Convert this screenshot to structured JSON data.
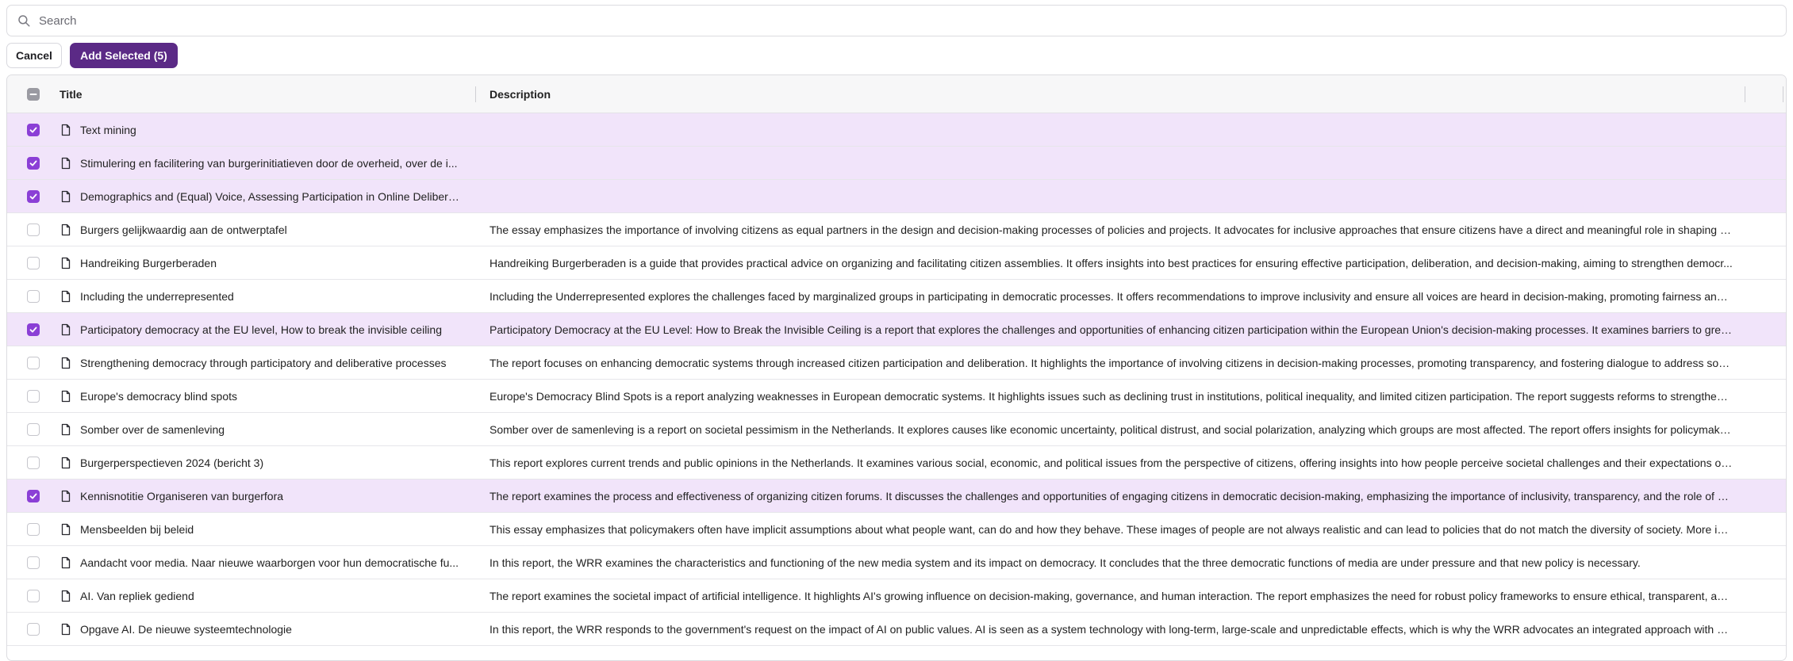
{
  "search": {
    "placeholder": "Search",
    "value": ""
  },
  "actions": {
    "cancel_label": "Cancel",
    "add_label": "Add Selected (5)"
  },
  "colors": {
    "accent": "#5b2a86",
    "checkbox_checked": "#8b3fd6",
    "selected_row": "#f1e4fa"
  },
  "table": {
    "headers": {
      "title": "Title",
      "description": "Description"
    },
    "rows": [
      {
        "title": "Text mining",
        "description": "",
        "selected": true
      },
      {
        "title": "Stimulering en facilitering van burgerinitiatieven door de overheid, over de i...",
        "description": "",
        "selected": true
      },
      {
        "title": "Demographics and (Equal) Voice, Assessing Participation in Online Deliberat...",
        "description": "",
        "selected": true
      },
      {
        "title": "Burgers gelijkwaardig aan de ontwerptafel",
        "description": "The essay emphasizes the importance of involving citizens as equal partners in the design and decision-making processes of policies and projects. It advocates for inclusive approaches that ensure citizens have a direct and meaningful role in shaping deci...",
        "selected": false
      },
      {
        "title": "Handreiking Burgerberaden",
        "description": "Handreiking Burgerberaden is a guide that provides practical advice on organizing and facilitating citizen assemblies. It offers insights into best practices for ensuring effective participation, deliberation, and decision-making, aiming to strengthen democr...",
        "selected": false
      },
      {
        "title": "Including the underrepresented",
        "description": "Including the Underrepresented explores the challenges faced by marginalized groups in participating in democratic processes. It offers recommendations to improve inclusivity and ensure all voices are heard in decision-making, promoting fairness and e...",
        "selected": false
      },
      {
        "title": "Participatory democracy at the EU level, How to break the invisible ceiling",
        "description": "Participatory Democracy at the EU Level: How to Break the Invisible Ceiling is a report that explores the challenges and opportunities of enhancing citizen participation within the European Union's decision-making processes. It examines barriers to greate...",
        "selected": true
      },
      {
        "title": "Strengthening democracy through participatory and deliberative processes",
        "description": "The report focuses on enhancing democratic systems through increased citizen participation and deliberation. It highlights the importance of involving citizens in decision-making processes, promoting transparency, and fostering dialogue to address soci...",
        "selected": false
      },
      {
        "title": "Europe's democracy blind spots",
        "description": "Europe's Democracy Blind Spots is a report analyzing weaknesses in European democratic systems. It highlights issues such as declining trust in institutions, political inequality, and limited citizen participation. The report suggests reforms to strengthen d...",
        "selected": false
      },
      {
        "title": "Somber over de samenleving",
        "description": "Somber over de samenleving is a report on societal pessimism in the Netherlands. It explores causes like economic uncertainty, political distrust, and social polarization, analyzing which groups are most affected. The report offers insights for policymakers...",
        "selected": false
      },
      {
        "title": "Burgerperspectieven 2024 (bericht 3)",
        "description": "This report explores current trends and public opinions in the Netherlands. It examines various social, economic, and political issues from the perspective of citizens, offering insights into how people perceive societal challenges and their expectations of g...",
        "selected": false
      },
      {
        "title": "Kennisnotitie Organiseren van burgerfora",
        "description": "The report examines the process and effectiveness of organizing citizen forums. It discusses the challenges and opportunities of engaging citizens in democratic decision-making, emphasizing the importance of inclusivity, transparency, and the role of suc...",
        "selected": true
      },
      {
        "title": "Mensbeelden bij beleid",
        "description": "This essay emphasizes that policymakers often have implicit assumptions about what people want, can do and how they behave. These images of people are not always realistic and can lead to policies that do not match the diversity of society. More invo...",
        "selected": false
      },
      {
        "title": "Aandacht voor media. Naar nieuwe waarborgen voor hun democratische fu...",
        "description": "In this report, the WRR examines the characteristics and functioning of the new media system and its impact on democracy. It concludes that the three democratic functions of media are under pressure and that new policy is necessary.",
        "selected": false
      },
      {
        "title": "AI. Van repliek gediend",
        "description": "The report examines the societal impact of artificial intelligence. It highlights AI's growing influence on decision-making, governance, and human interaction. The report emphasizes the need for robust policy frameworks to ensure ethical, transparent, and...",
        "selected": false
      },
      {
        "title": "Opgave AI. De nieuwe systeemtechnologie",
        "description": "In this report, the WRR responds to the government's request on the impact of AI on public values. AI is seen as a system technology with long-term, large-scale and unpredictable effects, which is why the WRR advocates an integrated approach with stro...",
        "selected": false
      }
    ]
  }
}
